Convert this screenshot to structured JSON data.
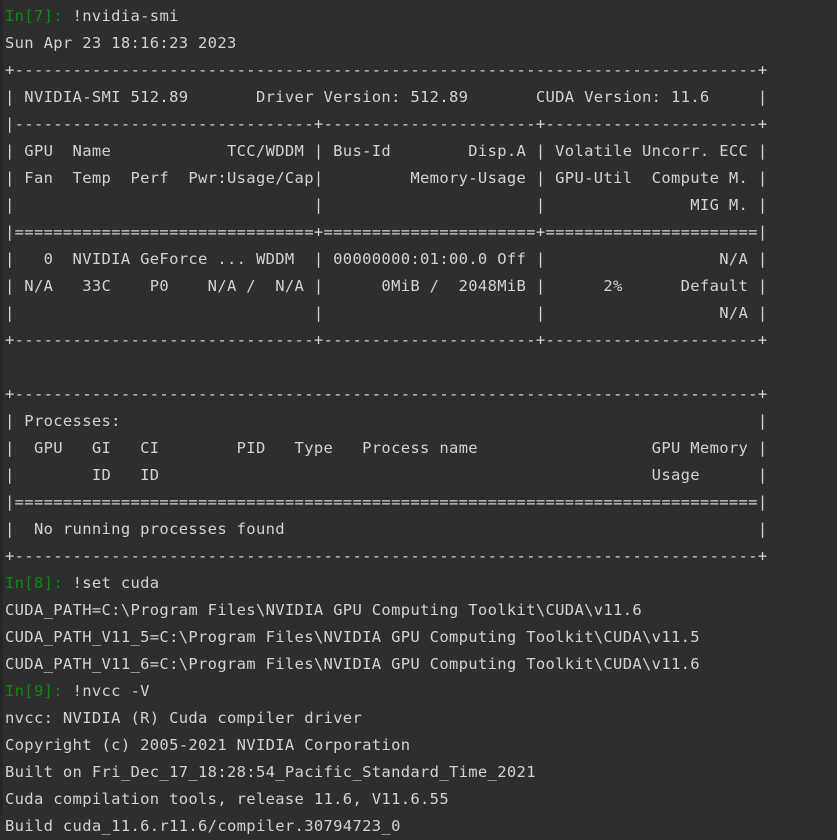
{
  "theme": {
    "background": "#2e2e2e",
    "foreground": "#d6d2cc",
    "prompt_color": "#0f8a15",
    "gutter": "#262628"
  },
  "console": {
    "type": "jupyter-console-transcript",
    "cells": [
      {
        "prompt": "In[7]:",
        "command": "!nvidia-smi",
        "output": [
          "Sun Apr 23 18:16:23 2023",
          "+-----------------------------------------------------------------------------+",
          "| NVIDIA-SMI 512.89       Driver Version: 512.89       CUDA Version: 11.6     |",
          "|-------------------------------+----------------------+----------------------+",
          "| GPU  Name            TCC/WDDM | Bus-Id        Disp.A | Volatile Uncorr. ECC |",
          "| Fan  Temp  Perf  Pwr:Usage/Cap|         Memory-Usage | GPU-Util  Compute M. |",
          "|                               |                      |               MIG M. |",
          "|===============================+======================+======================|",
          "|   0  NVIDIA GeForce ... WDDM  | 00000000:01:00.0 Off |                  N/A |",
          "| N/A   33C    P0    N/A /  N/A |      0MiB /  2048MiB |      2%      Default |",
          "|                               |                      |                  N/A |",
          "+-------------------------------+----------------------+----------------------+",
          "",
          "+-----------------------------------------------------------------------------+",
          "| Processes:                                                                  |",
          "|  GPU   GI   CI        PID   Type   Process name                  GPU Memory |",
          "|        ID   ID                                                   Usage      |",
          "|=============================================================================|",
          "|  No running processes found                                                 |",
          "+-----------------------------------------------------------------------------+"
        ]
      },
      {
        "prompt": "In[8]:",
        "command": "!set cuda",
        "output": [
          "CUDA_PATH=C:\\Program Files\\NVIDIA GPU Computing Toolkit\\CUDA\\v11.6",
          "CUDA_PATH_V11_5=C:\\Program Files\\NVIDIA GPU Computing Toolkit\\CUDA\\v11.5",
          "CUDA_PATH_V11_6=C:\\Program Files\\NVIDIA GPU Computing Toolkit\\CUDA\\v11.6"
        ]
      },
      {
        "prompt": "In[9]:",
        "command": "!nvcc -V",
        "output": [
          "nvcc: NVIDIA (R) Cuda compiler driver",
          "Copyright (c) 2005-2021 NVIDIA Corporation",
          "Built on Fri_Dec_17_18:28:54_Pacific_Standard_Time_2021",
          "Cuda compilation tools, release 11.6, V11.6.55",
          "Build cuda_11.6.r11.6/compiler.30794723_0"
        ]
      }
    ],
    "nvidia_smi": {
      "timestamp": "Sun Apr 23 18:16:23 2023",
      "smi_version": "512.89",
      "driver_version": "512.89",
      "cuda_version": "11.6",
      "gpu": {
        "index": "0",
        "name": "NVIDIA GeForce ...",
        "tcc_wddm": "WDDM",
        "bus_id": "00000000:01:00.0",
        "disp_a": "Off",
        "uncorr_ecc": "N/A",
        "fan": "N/A",
        "temp": "33C",
        "perf": "P0",
        "pwr_usage_cap": "N/A /  N/A",
        "memory_usage": "0MiB /  2048MiB",
        "gpu_util": "2%",
        "compute_m": "Default",
        "mig_m": "N/A"
      },
      "processes": {
        "header": "Processes:",
        "columns": [
          "GPU",
          "GI ID",
          "CI ID",
          "PID",
          "Type",
          "Process name",
          "GPU Memory Usage"
        ],
        "message": "No running processes found"
      }
    },
    "cuda_env": {
      "CUDA_PATH": "C:\\Program Files\\NVIDIA GPU Computing Toolkit\\CUDA\\v11.6",
      "CUDA_PATH_V11_5": "C:\\Program Files\\NVIDIA GPU Computing Toolkit\\CUDA\\v11.5",
      "CUDA_PATH_V11_6": "C:\\Program Files\\NVIDIA GPU Computing Toolkit\\CUDA\\v11.6"
    },
    "nvcc": {
      "driver": "nvcc: NVIDIA (R) Cuda compiler driver",
      "copyright": "Copyright (c) 2005-2021 NVIDIA Corporation",
      "built_on": "Built on Fri_Dec_17_18:28:54_Pacific_Standard_Time_2021",
      "release": "Cuda compilation tools, release 11.6, V11.6.55",
      "build": "Build cuda_11.6.r11.6/compiler.30794723_0"
    }
  }
}
